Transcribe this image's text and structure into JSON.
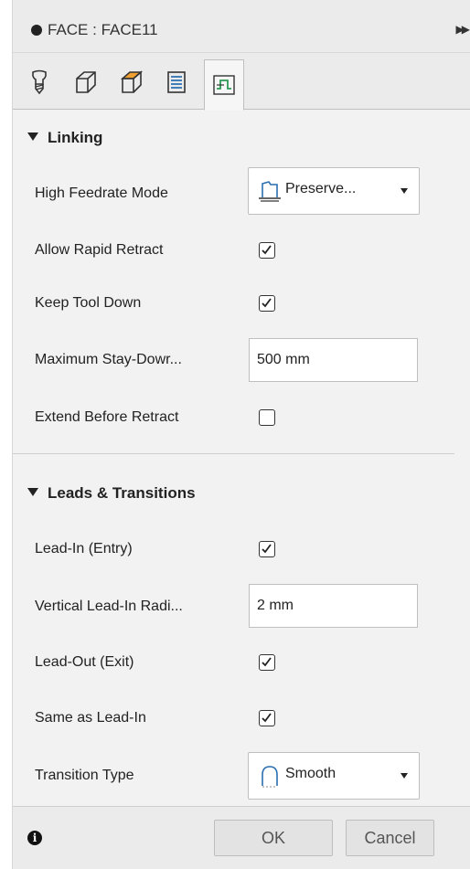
{
  "window": {
    "title": "FACE : FACE11"
  },
  "tabs": [
    {
      "icon": "tool-icon",
      "active": false
    },
    {
      "icon": "geometry-icon",
      "active": false
    },
    {
      "icon": "heights-icon",
      "active": false
    },
    {
      "icon": "passes-icon",
      "active": false
    },
    {
      "icon": "linking-icon",
      "active": true
    }
  ],
  "linking": {
    "header": "Linking",
    "high_feedrate_label": "High Feedrate Mode",
    "high_feedrate_value": "Preserve...",
    "allow_rapid_retract_label": "Allow Rapid Retract",
    "allow_rapid_retract_checked": true,
    "keep_tool_down_label": "Keep Tool Down",
    "keep_tool_down_checked": true,
    "max_stay_down_label": "Maximum Stay-Dowr...",
    "max_stay_down_value": "500 mm",
    "extend_before_retract_label": "Extend Before Retract",
    "extend_before_retract_checked": false
  },
  "leads": {
    "header": "Leads & Transitions",
    "lead_in_label": "Lead-In (Entry)",
    "lead_in_checked": true,
    "vertical_lead_in_label": "Vertical Lead-In Radi...",
    "vertical_lead_in_value": "2 mm",
    "lead_out_label": "Lead-Out (Exit)",
    "lead_out_checked": true,
    "same_as_lead_in_label": "Same as Lead-In",
    "same_as_lead_in_checked": true,
    "transition_type_label": "Transition Type",
    "transition_type_value": "Smooth"
  },
  "footer": {
    "ok_label": "OK",
    "cancel_label": "Cancel"
  }
}
